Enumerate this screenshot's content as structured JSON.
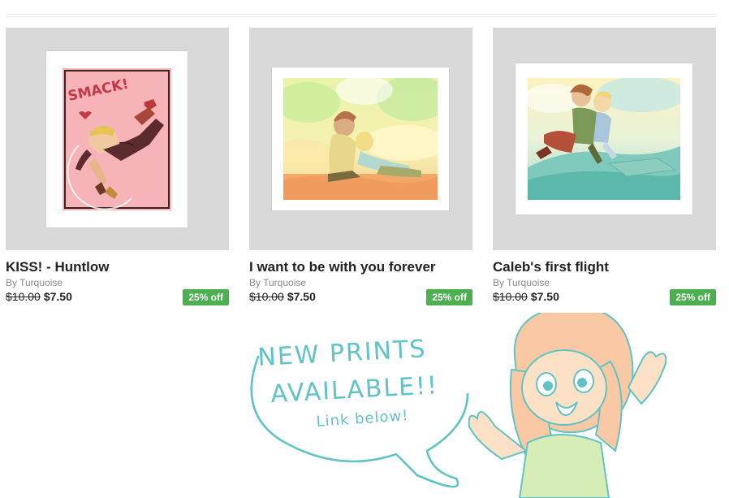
{
  "products": [
    {
      "title": "KISS! - Huntlow",
      "author": "By Turquoise",
      "old_price": "$10.00",
      "price": "$7.50",
      "discount": "25% off",
      "art_text": "SMACK!"
    },
    {
      "title": "I want to be with you forever",
      "author": "By Turquoise",
      "old_price": "$10.00",
      "price": "$7.50",
      "discount": "25% off"
    },
    {
      "title": "Caleb's first flight",
      "author": "By Turquoise",
      "old_price": "$10.00",
      "price": "$7.50",
      "discount": "25% off"
    }
  ],
  "promo": {
    "line1": "NEW PRINTS",
    "line2": "AVAILABLE!!",
    "line3": "Link below!"
  },
  "colors": {
    "badge": "#4caf50",
    "thumb_bg": "#d9d9d9",
    "handwriting": "#61c3c4"
  }
}
